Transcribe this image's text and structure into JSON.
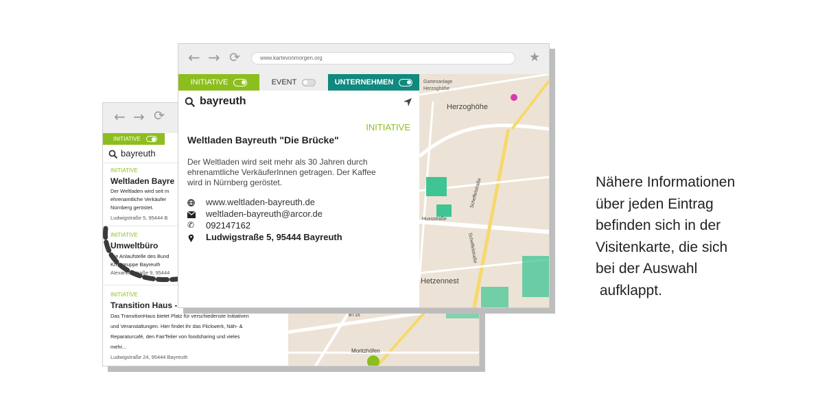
{
  "back_window": {
    "tab_initiative": "INITIATIVE",
    "search_value": "bayreuth",
    "results": [
      {
        "category": "INITIATIVE",
        "title": "Weltladen Bayre",
        "desc1": "Der Weltladen wird seit m",
        "desc2": "ehrenamtliche Verkäufer",
        "desc3": "Nürnberg geröstet.",
        "desc4": "",
        "address": "Ludwigstraße 5, 95444 B"
      },
      {
        "category": "INITIATIVE",
        "title": "Umweltbüro",
        "desc1": "Die Anlaufstelle des Bund",
        "desc2": "Kreisgruppe Bayreuth",
        "desc3": "",
        "desc4": "",
        "address": "Alexanderstraße 9, 95444"
      },
      {
        "category": "INITIATIVE",
        "title": "Transition Haus - Bayreuth",
        "desc1": "Das TransitionHaus bietet Platz für verschiedenste Initiativen",
        "desc2": "und Veranstaltungen. Hier findet ihr das Flickwerk, Näh- &",
        "desc3": "Reparaturcafé, den FairTeiler von foodsharing und vieles",
        "desc4": "mehr...",
        "address": "Ludwigstraße 24, 95444 Bayreuth"
      }
    ],
    "map_labels": {
      "label1": "BT15",
      "label2": "Moritzhöfen"
    }
  },
  "front_window": {
    "url": "www.kartevonmorgen.org",
    "tabs": {
      "initiative": "INITIATIVE",
      "event": "EVENT",
      "unternehmen": "UNTERNEHMEN"
    },
    "search_value": "bayreuth",
    "card": {
      "category": "INITIATIVE",
      "title": "Weltladen Bayreuth \"Die Brücke\"",
      "desc_line1": "Der Weltladen wird seit mehr als 30 Jahren durch",
      "desc_line2": "ehrenamtliche VerkäuferInnen getragen. Der Kaffee",
      "desc_line3": "wird in Nürnberg geröstet.",
      "website": "www.weltladen-bayreuth.de",
      "email": "weltladen-bayreuth@arcor.de",
      "phone": "092147162",
      "address": "Ludwigstraße 5, 95444 Bayreuth"
    },
    "map_labels": {
      "herzoghoehe": "Herzoghöhe",
      "gartenanlage1": "Gartenanlage",
      "gartenanlage2": "Herzoghöhe",
      "street1": "Scheffelstraße",
      "street2": "Scheffelstraße",
      "street3": "Hussstraße",
      "hetzennest": "Hetzennest"
    }
  },
  "caption": {
    "line1": "Nähere Informationen",
    "line2": "über jeden Eintrag",
    "line3": "befinden sich in der",
    "line4": "Visitenkarte, die sich",
    "line5": "bei der Auswahl",
    "line6": " aufklappt."
  },
  "colors": {
    "initiative": "#8cbe1e",
    "unternehmen": "#10897f",
    "event_bg": "#eeeeee",
    "park": "#3fc493"
  }
}
